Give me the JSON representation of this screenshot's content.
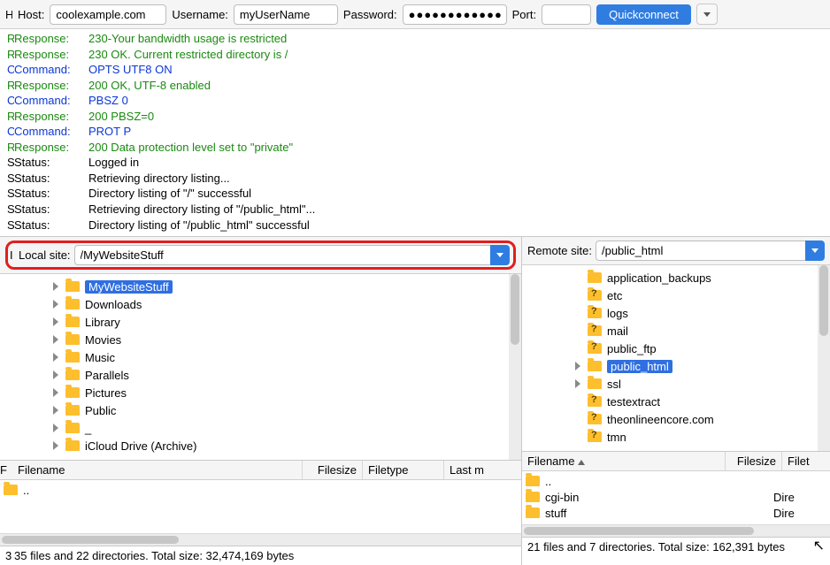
{
  "conn": {
    "host_label": "Host:",
    "host_value": "coolexample.com",
    "user_label": "Username:",
    "user_value": "myUserName",
    "pass_label": "Password:",
    "pass_value": "●●●●●●●●●●●●",
    "port_label": "Port:",
    "port_value": "",
    "quickconnect": "Quickconnect"
  },
  "log": [
    {
      "cls": "green",
      "leading": "R",
      "label": "Response:",
      "msg": "230-Your bandwidth usage is restricted"
    },
    {
      "cls": "green",
      "leading": "R",
      "label": "Response:",
      "msg": "230 OK. Current restricted directory is /"
    },
    {
      "cls": "blue",
      "leading": "C",
      "label": "Command:",
      "msg": "OPTS UTF8 ON"
    },
    {
      "cls": "green",
      "leading": "R",
      "label": "Response:",
      "msg": "200 OK, UTF-8 enabled"
    },
    {
      "cls": "blue",
      "leading": "C",
      "label": "Command:",
      "msg": "PBSZ 0"
    },
    {
      "cls": "green",
      "leading": "R",
      "label": "Response:",
      "msg": "200 PBSZ=0"
    },
    {
      "cls": "blue",
      "leading": "C",
      "label": "Command:",
      "msg": "PROT P"
    },
    {
      "cls": "green",
      "leading": "R",
      "label": "Response:",
      "msg": "200 Data protection level set to \"private\""
    },
    {
      "cls": "black",
      "leading": "S",
      "label": "Status:",
      "msg": "Logged in"
    },
    {
      "cls": "black",
      "leading": "S",
      "label": "Status:",
      "msg": "Retrieving directory listing..."
    },
    {
      "cls": "black",
      "leading": "S",
      "label": "Status:",
      "msg": "Directory listing of \"/\" successful"
    },
    {
      "cls": "black",
      "leading": "S",
      "label": "Status:",
      "msg": "Retrieving directory listing of \"/public_html\"..."
    },
    {
      "cls": "black",
      "leading": "S",
      "label": "Status:",
      "msg": "Directory listing of \"/public_html\" successful"
    }
  ],
  "local": {
    "leading": "I",
    "label": "Local site:",
    "path": "/MyWebsiteStuff",
    "tree": [
      {
        "name": "MyWebsiteStuff",
        "selected": true,
        "arrow": true,
        "q": false,
        "indent": 0
      },
      {
        "name": "Downloads",
        "selected": false,
        "arrow": true,
        "q": false,
        "indent": 0
      },
      {
        "name": "Library",
        "selected": false,
        "arrow": true,
        "q": false,
        "indent": 0
      },
      {
        "name": "Movies",
        "selected": false,
        "arrow": true,
        "q": false,
        "indent": 0
      },
      {
        "name": "Music",
        "selected": false,
        "arrow": true,
        "q": false,
        "indent": 0
      },
      {
        "name": "Parallels",
        "selected": false,
        "arrow": true,
        "q": false,
        "indent": 0
      },
      {
        "name": "Pictures",
        "selected": false,
        "arrow": true,
        "q": false,
        "indent": 0
      },
      {
        "name": "Public",
        "selected": false,
        "arrow": true,
        "q": false,
        "indent": 0
      },
      {
        "name": "_",
        "selected": false,
        "arrow": true,
        "q": false,
        "indent": 0
      },
      {
        "name": "iCloud Drive (Archive)",
        "selected": false,
        "arrow": true,
        "q": false,
        "indent": 0
      }
    ],
    "cols": {
      "lead": "F",
      "c1": "Filename",
      "c2": "Filesize",
      "c3": "Filetype",
      "c4": "Last m"
    },
    "rows": [
      {
        "name": "..",
        "type": ""
      }
    ],
    "status_lead": "3",
    "status": "35 files and 22 directories. Total size: 32,474,169 bytes"
  },
  "remote": {
    "label": "Remote site:",
    "path": "/public_html",
    "tree": [
      {
        "name": "application_backups",
        "selected": false,
        "arrow": false,
        "q": false,
        "indent": 0
      },
      {
        "name": "etc",
        "selected": false,
        "arrow": false,
        "q": true,
        "indent": 0
      },
      {
        "name": "logs",
        "selected": false,
        "arrow": false,
        "q": true,
        "indent": 0
      },
      {
        "name": "mail",
        "selected": false,
        "arrow": false,
        "q": true,
        "indent": 0
      },
      {
        "name": "public_ftp",
        "selected": false,
        "arrow": false,
        "q": true,
        "indent": 0
      },
      {
        "name": "public_html",
        "selected": true,
        "arrow": true,
        "q": false,
        "indent": 0
      },
      {
        "name": "ssl",
        "selected": false,
        "arrow": true,
        "q": false,
        "indent": 0
      },
      {
        "name": "testextract",
        "selected": false,
        "arrow": false,
        "q": true,
        "indent": 0
      },
      {
        "name": "theonlineencore.com",
        "selected": false,
        "arrow": false,
        "q": true,
        "indent": 0
      },
      {
        "name": "tmn",
        "selected": false,
        "arrow": false,
        "q": true,
        "indent": 0
      }
    ],
    "cols": {
      "c1": "Filename",
      "c2": "Filesize",
      "c3": "Filet"
    },
    "rows": [
      {
        "name": "..",
        "type": ""
      },
      {
        "name": "cgi-bin",
        "type": "Dire"
      },
      {
        "name": "stuff",
        "type": "Dire"
      }
    ],
    "status": "21 files and 7 directories. Total size: 162,391 bytes"
  }
}
